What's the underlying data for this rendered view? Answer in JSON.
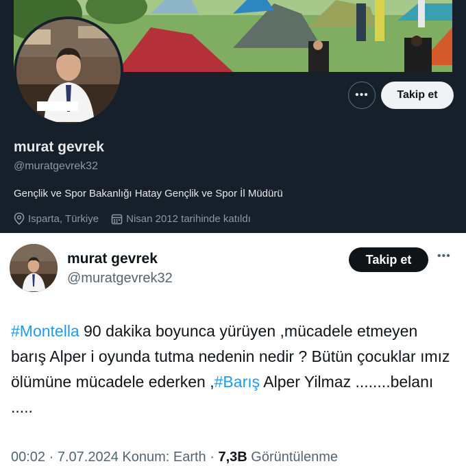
{
  "profile": {
    "name": "murat gevrek",
    "handle": "@muratgevrek32",
    "bio": "Gençlik ve Spor Bakanlığı  Hatay Gençlik ve Spor İl Müdürü",
    "location": "Isparta, Türkiye",
    "joined": "Nisan 2012 tarihinde katıldı",
    "follow_label": "Takip et",
    "more_icon": "more-options-icon",
    "location_icon": "location-pin-icon",
    "calendar_icon": "calendar-icon"
  },
  "tweet": {
    "author_name": "murat gevrek",
    "author_handle": "@muratgevrek32",
    "follow_label": "Takip et",
    "text": {
      "hashtag1": "#Montella",
      "part1": " 90 dakika boyunca yürüyen ,mücadele etmeyen barış Alper i oyunda tutma nedenin nedir ? Bütün çocuklar ımız ölümüne mücadele ederken ,",
      "hashtag2": "#Barış",
      "part2": " Alper Yilmaz ........belanı ....."
    },
    "meta": {
      "time": "00:02",
      "dot1": " · ",
      "date": "7.07.2024",
      "location": " Konum: Earth",
      "dot2": " · ",
      "views_count": "7,3B",
      "views_label": " Görüntülenme"
    }
  },
  "colors": {
    "dark_bg": "#15202b",
    "link": "#1d9bf0",
    "text_dark": "#0f1419",
    "text_muted": "#536471"
  }
}
